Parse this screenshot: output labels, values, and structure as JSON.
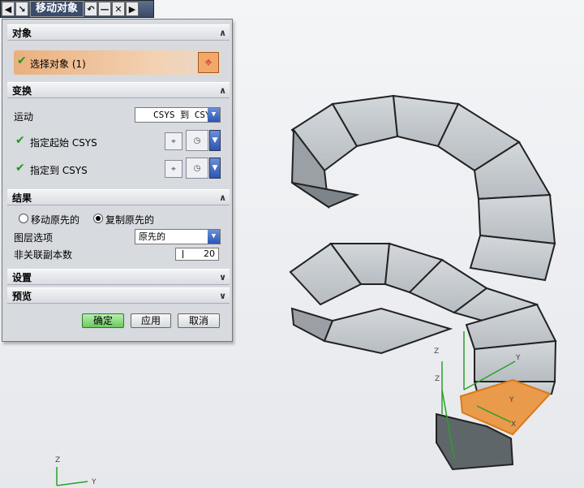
{
  "window": {
    "title": "移动对象",
    "title_icons": [
      "back-arrow-icon",
      "pin-arrow-icon",
      "undo-icon",
      "minimize-icon",
      "close-icon",
      "forward-arrow-icon"
    ]
  },
  "sections": {
    "object": {
      "header": "对象",
      "select_label": "选择对象 (1)"
    },
    "transform": {
      "header": "变换",
      "motion_label": "运动",
      "motion_value": "CSYS 到 CSYS",
      "start_csys_label": "指定起始 CSYS",
      "to_csys_label": "指定到 CSYS"
    },
    "result": {
      "header": "结果",
      "move_original_label": "移动原先的",
      "copy_original_label": "复制原先的",
      "selected_option": "复制原先的",
      "layer_label": "图层选项",
      "layer_value": "原先的",
      "copies_label": "非关联副本数",
      "copies_value": "20"
    },
    "settings": {
      "header": "设置"
    },
    "preview": {
      "header": "预览"
    }
  },
  "buttons": {
    "ok": "确定",
    "apply": "应用",
    "cancel": "取消"
  },
  "axes": {
    "corner_z": "Z",
    "corner_y": "Y",
    "csys_z1": "Z",
    "csys_z2": "Z",
    "csys_y1": "Y",
    "csys_y2": "Y",
    "csys_x": "X"
  },
  "colors": {
    "highlight": "#f0a050",
    "check": "#1a9a1a",
    "stair": "#c3c8cc"
  }
}
